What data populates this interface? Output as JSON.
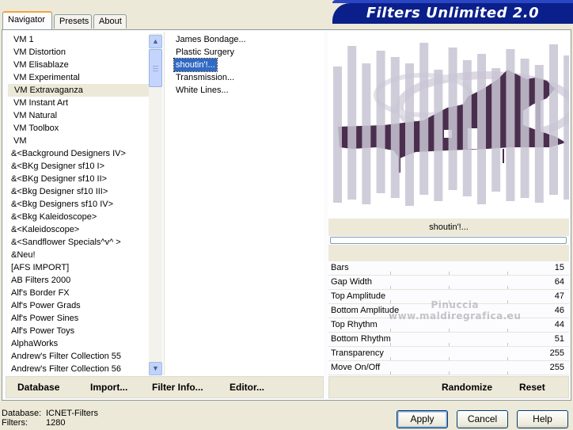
{
  "tabs": [
    {
      "label": "Navigator",
      "active": true
    },
    {
      "label": "Presets",
      "active": false
    },
    {
      "label": "About",
      "active": false
    }
  ],
  "brand": "Filters Unlimited 2.0",
  "categories": [
    "VM 1",
    "VM Distortion",
    "VM Elisablaze",
    "VM Experimental",
    "VM Extravaganza",
    "VM Instant Art",
    "VM Natural",
    "VM Toolbox",
    "VM",
    "&<Background Designers IV>",
    "&<BKg Designer sf10 I>",
    "&<BKg Designer sf10 II>",
    "&<Bkg Designer sf10 III>",
    "&<Bkg Designers sf10 IV>",
    "&<Bkg Kaleidoscope>",
    "&<Kaleidoscope>",
    "&<Sandflower Specials^v^ >",
    "&Neu!",
    "[AFS IMPORT]",
    "AB Filters 2000",
    "Alf's Border FX",
    "Alf's Power Grads",
    "Alf's Power Sines",
    "Alf's Power Toys",
    "AlphaWorks",
    "Andrew's Filter Collection 55",
    "Andrew's Filter Collection 56"
  ],
  "selected_category": "VM Extravaganza",
  "filters": [
    "James Bondage...",
    "Plastic Surgery",
    "shoutin'!...",
    "Transmission...",
    "White Lines..."
  ],
  "selected_filter": "shoutin'!...",
  "preview_caption": "shoutin'!...",
  "params": [
    {
      "label": "Bars",
      "value": "15"
    },
    {
      "label": "Gap Width",
      "value": "64"
    },
    {
      "label": "Top Amplitude",
      "value": "47"
    },
    {
      "label": "Bottom Amplitude",
      "value": "46"
    },
    {
      "label": "Top Rhythm",
      "value": "44"
    },
    {
      "label": "Bottom Rhythm",
      "value": "51"
    },
    {
      "label": "Transparency",
      "value": "255"
    },
    {
      "label": "Move On/Off",
      "value": "255"
    }
  ],
  "watermark": {
    "line1": "Pinuccia",
    "line2": "www.maldiregrafica.eu"
  },
  "toolbar": {
    "database": "Database",
    "import": "Import...",
    "filter_info": "Filter Info...",
    "editor": "Editor...",
    "randomize": "Randomize",
    "reset": "Reset"
  },
  "status": {
    "database_label": "Database:",
    "database_value": "ICNET-Filters",
    "filters_label": "Filters:",
    "filters_value": "1280"
  },
  "buttons": {
    "apply": "Apply",
    "cancel": "Cancel",
    "help": "Help"
  },
  "colors": {
    "brand_bg": "#0a1f8a",
    "selection": "#316ac5",
    "preview_dark": "#4a2e4e",
    "preview_bar": "#c8c4d4"
  }
}
